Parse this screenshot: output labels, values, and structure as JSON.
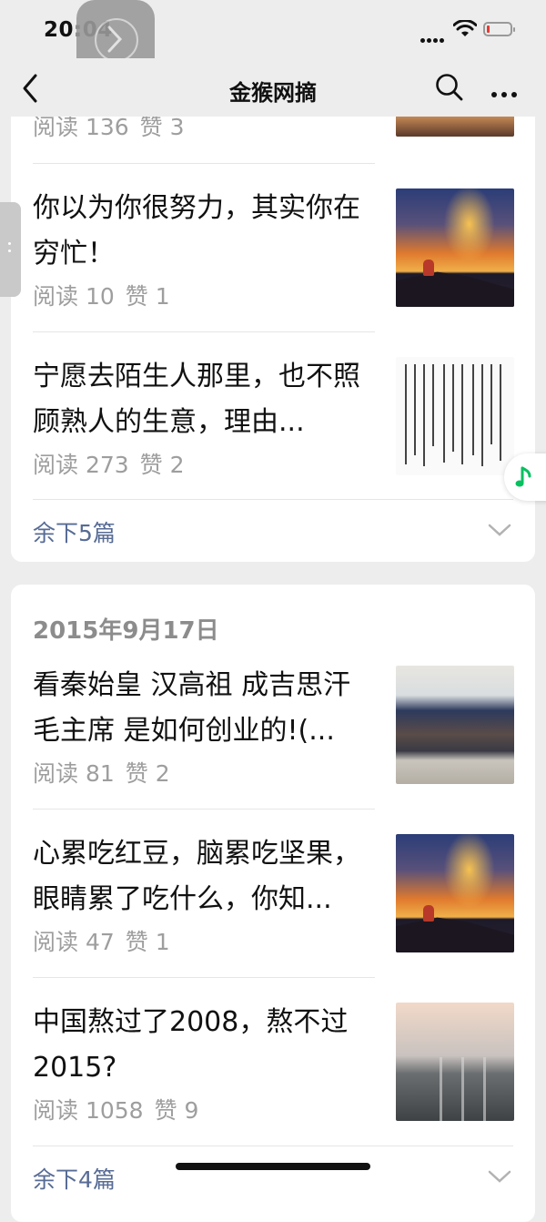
{
  "status_bar": {
    "time": "20:04"
  },
  "nav": {
    "title": "金猴网摘"
  },
  "card1": {
    "partial_item": {
      "reads": "阅读 136",
      "likes": "赞 3"
    },
    "items": [
      {
        "title": "你以为你很努力，其实你在穷忙！",
        "reads": "阅读 10",
        "likes": "赞 1",
        "thumbnail": "sunset-mountain-figure"
      },
      {
        "title": "宁愿去陌生人那里，也不照顾熟人的生意，理由...",
        "reads": "阅读 273",
        "likes": "赞 2",
        "thumbnail": "chinese-text-page"
      }
    ],
    "more_label": "余下5篇"
  },
  "card2": {
    "date": "2015年9月17日",
    "items": [
      {
        "title": "看秦始皇 汉高祖 成吉思汗 毛主席 是如何创业的!(...",
        "reads": "阅读 81",
        "likes": "赞 2",
        "thumbnail": "group-photo"
      },
      {
        "title": "心累吃红豆，脑累吃坚果，眼睛累了吃什么，你知...",
        "reads": "阅读 47",
        "likes": "赞 1",
        "thumbnail": "sunset-mountain-figure"
      },
      {
        "title": "中国熬过了2008，熬不过2015?",
        "reads": "阅读 1058",
        "likes": "赞 9",
        "thumbnail": "highway-traffic"
      }
    ],
    "more_label": "余下4篇"
  },
  "colors": {
    "link": "#576b95",
    "meta": "#9e9e9e",
    "background": "#ededed",
    "music": "#07c160"
  }
}
